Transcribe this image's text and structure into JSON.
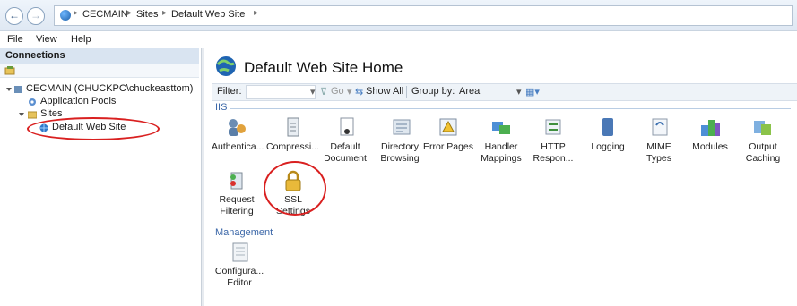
{
  "address_bar": {
    "back_glyph": "←",
    "forward_glyph": "→",
    "breadcrumbs": [
      "CECMAIN",
      "Sites",
      "Default Web Site"
    ],
    "separator": "▸"
  },
  "menu": [
    "File",
    "View",
    "Help"
  ],
  "connections": {
    "title": "Connections",
    "tree": {
      "server": "CECMAIN (CHUCKPC\\chuckeasttom)",
      "app_pools": "Application Pools",
      "sites": "Sites",
      "default_site": "Default Web Site"
    }
  },
  "main": {
    "title": "Default Web Site Home",
    "filter_label": "Filter:",
    "go_label": "Go",
    "show_all_label": "Show All",
    "group_by_label": "Group by:",
    "group_by_value": "Area",
    "sections": {
      "iis": "IIS",
      "management": "Management"
    },
    "features": [
      {
        "label": "Authentica...",
        "icon": "authentication-icon"
      },
      {
        "label": "Compressi...",
        "icon": "compression-icon"
      },
      {
        "label": "Default Document",
        "icon": "default-document-icon"
      },
      {
        "label": "Directory Browsing",
        "icon": "directory-browsing-icon"
      },
      {
        "label": "Error Pages",
        "icon": "error-pages-icon"
      },
      {
        "label": "Handler Mappings",
        "icon": "handler-mappings-icon"
      },
      {
        "label": "HTTP Respon...",
        "icon": "http-response-icon"
      },
      {
        "label": "Logging",
        "icon": "logging-icon"
      },
      {
        "label": "MIME Types",
        "icon": "mime-types-icon"
      },
      {
        "label": "Modules",
        "icon": "modules-icon"
      },
      {
        "label": "Output Caching",
        "icon": "output-caching-icon"
      },
      {
        "label": "Request Filtering",
        "icon": "request-filtering-icon"
      },
      {
        "label": "SSL Settings",
        "icon": "lock-icon"
      }
    ],
    "management_features": [
      {
        "label": "Configura... Editor",
        "icon": "configuration-editor-icon"
      }
    ]
  },
  "colors": {
    "annotation_red": "#d92020",
    "section_blue": "#3b67a8"
  }
}
